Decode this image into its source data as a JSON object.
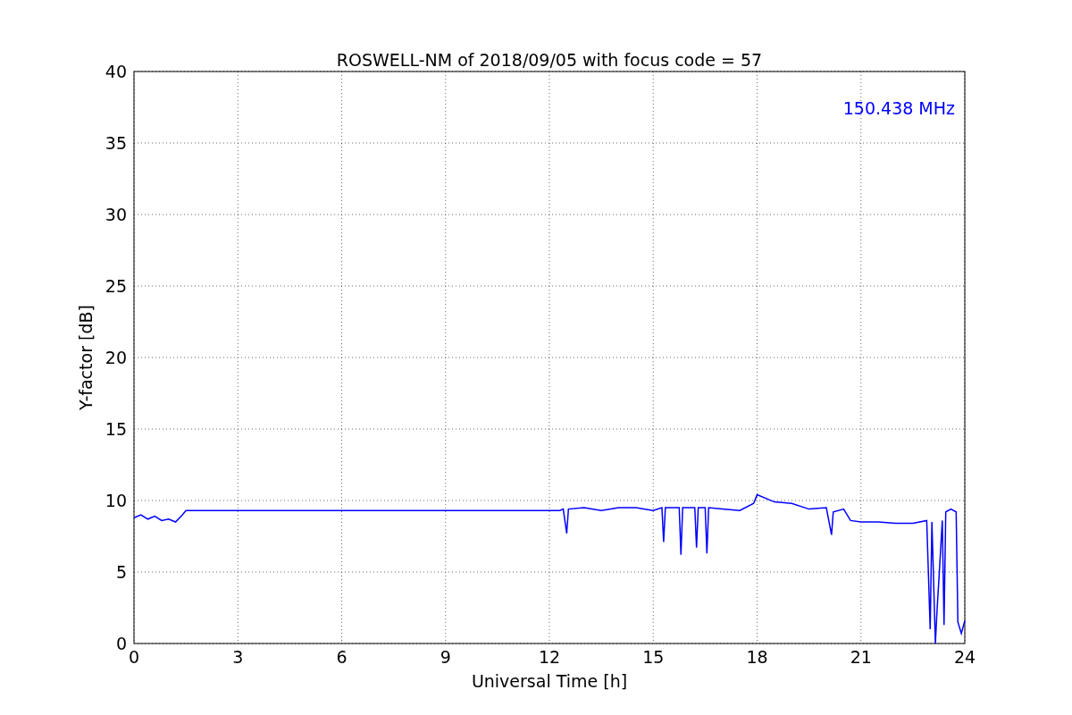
{
  "chart_data": {
    "type": "line",
    "title": "ROSWELL-NM of 2018/09/05 with focus code = 57",
    "xlabel": "Universal Time [h]",
    "ylabel": "Y-factor [dB]",
    "x": [
      0,
      0.2,
      0.4,
      0.6,
      0.8,
      1.0,
      1.2,
      1.4,
      1.5,
      12.3,
      12.4,
      12.5,
      12.55,
      13,
      13.5,
      14,
      14.5,
      15,
      15.25,
      15.3,
      15.35,
      15.75,
      15.8,
      15.85,
      16.2,
      16.25,
      16.3,
      16.5,
      16.55,
      16.6,
      17,
      17.5,
      17.9,
      18,
      18.5,
      19,
      19.5,
      20,
      20.15,
      20.2,
      20.5,
      20.7,
      21,
      21.5,
      22,
      22.5,
      22.9,
      23.0,
      23.05,
      23.15,
      23.2,
      23.25,
      23.35,
      23.4,
      23.45,
      23.6,
      23.75,
      23.8,
      23.9,
      24
    ],
    "series": [
      {
        "name": "150.438 MHz",
        "color": "#0000ff",
        "values": [
          8.8,
          9.0,
          8.7,
          8.9,
          8.6,
          8.7,
          8.5,
          9.0,
          9.3,
          9.3,
          9.4,
          7.7,
          9.4,
          9.5,
          9.3,
          9.5,
          9.5,
          9.3,
          9.5,
          7.1,
          9.5,
          9.5,
          6.2,
          9.5,
          9.5,
          6.7,
          9.5,
          9.5,
          6.3,
          9.5,
          9.4,
          9.3,
          9.8,
          10.4,
          9.9,
          9.8,
          9.4,
          9.5,
          7.6,
          9.2,
          9.4,
          8.6,
          8.5,
          8.5,
          8.4,
          8.4,
          8.6,
          1.0,
          8.5,
          0.0,
          2.4,
          4.4,
          8.6,
          1.3,
          9.2,
          9.4,
          9.2,
          1.5,
          0.7,
          1.6
        ]
      }
    ],
    "xlim": [
      0,
      24
    ],
    "ylim": [
      0,
      40
    ],
    "xticks": [
      0,
      3,
      6,
      9,
      12,
      15,
      18,
      21,
      24
    ],
    "yticks": [
      0,
      5,
      10,
      15,
      20,
      25,
      30,
      35,
      40
    ],
    "grid": true
  }
}
